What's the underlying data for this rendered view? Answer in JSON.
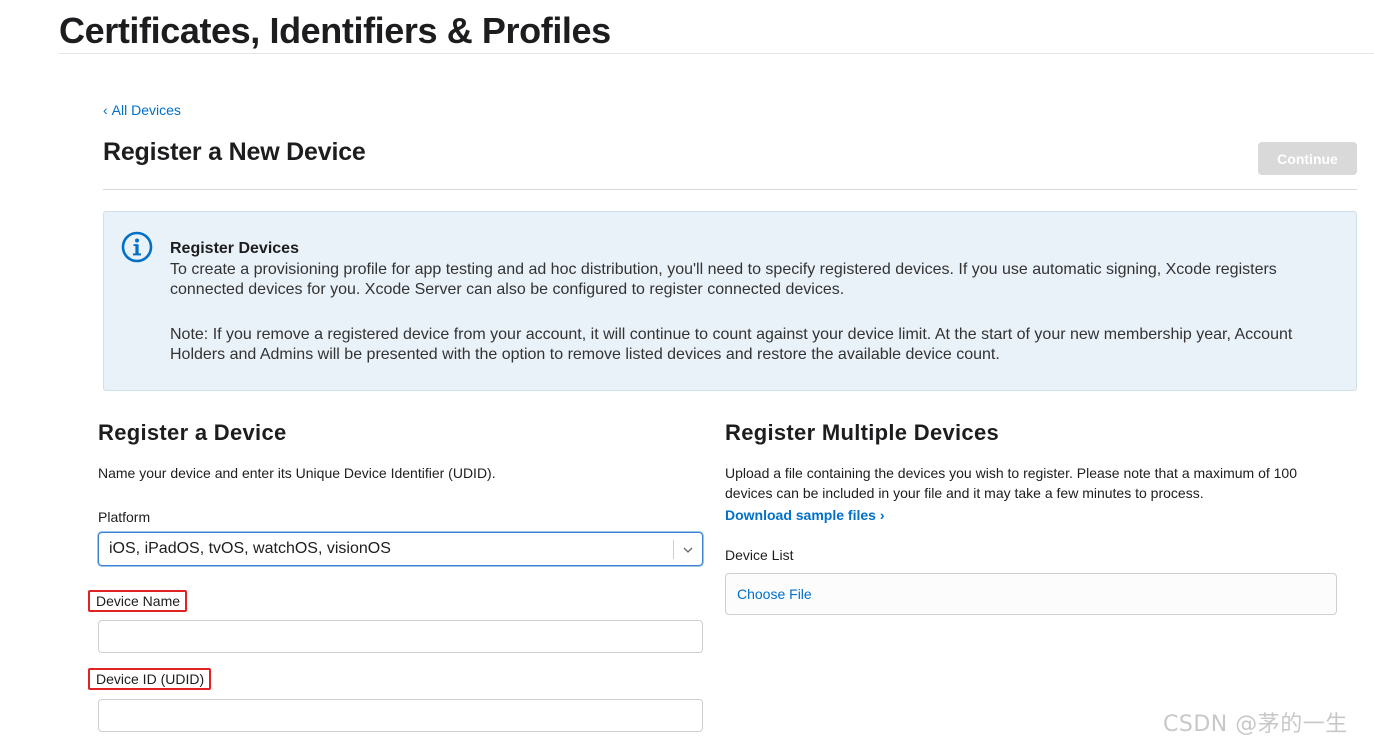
{
  "header": {
    "title": "Certificates, Identifiers & Profiles"
  },
  "nav": {
    "back_label": "All Devices",
    "back_chevron": "‹"
  },
  "section": {
    "title": "Register a New Device",
    "continue_label": "Continue"
  },
  "info": {
    "heading": "Register Devices",
    "paragraph1": "To create a provisioning profile for app testing and ad hoc distribution, you'll need to specify registered devices. If you use automatic signing, Xcode registers connected devices for you. Xcode Server can also be configured to register connected devices.",
    "paragraph2": "Note: If you remove a registered device from your account, it will continue to count against your device limit. At the start of your new membership year, Account Holders and Admins will be presented with the option to remove listed devices and restore the available device count.",
    "icon": "info-circle-icon"
  },
  "register_single": {
    "heading": "Register a Device",
    "description": "Name your device and enter its Unique Device Identifier (UDID).",
    "platform_label": "Platform",
    "platform_value": "iOS, iPadOS, tvOS, watchOS, visionOS",
    "device_name_label": "Device Name",
    "device_name_value": "",
    "udid_label": "Device ID (UDID)",
    "udid_value": ""
  },
  "register_multiple": {
    "heading": "Register Multiple Devices",
    "description": "Upload a file containing the devices you wish to register. Please note that a maximum of 100 devices can be included in your file and it may take a few minutes to process.",
    "download_label": "Download sample files ›",
    "device_list_label": "Device List",
    "choose_file_label": "Choose File"
  },
  "watermark": "CSDN @茅的一生",
  "colors": {
    "link": "#0070c9",
    "info_bg": "#eaf2f9",
    "highlight": "#e02424",
    "button_disabled": "#d9d9d9"
  }
}
